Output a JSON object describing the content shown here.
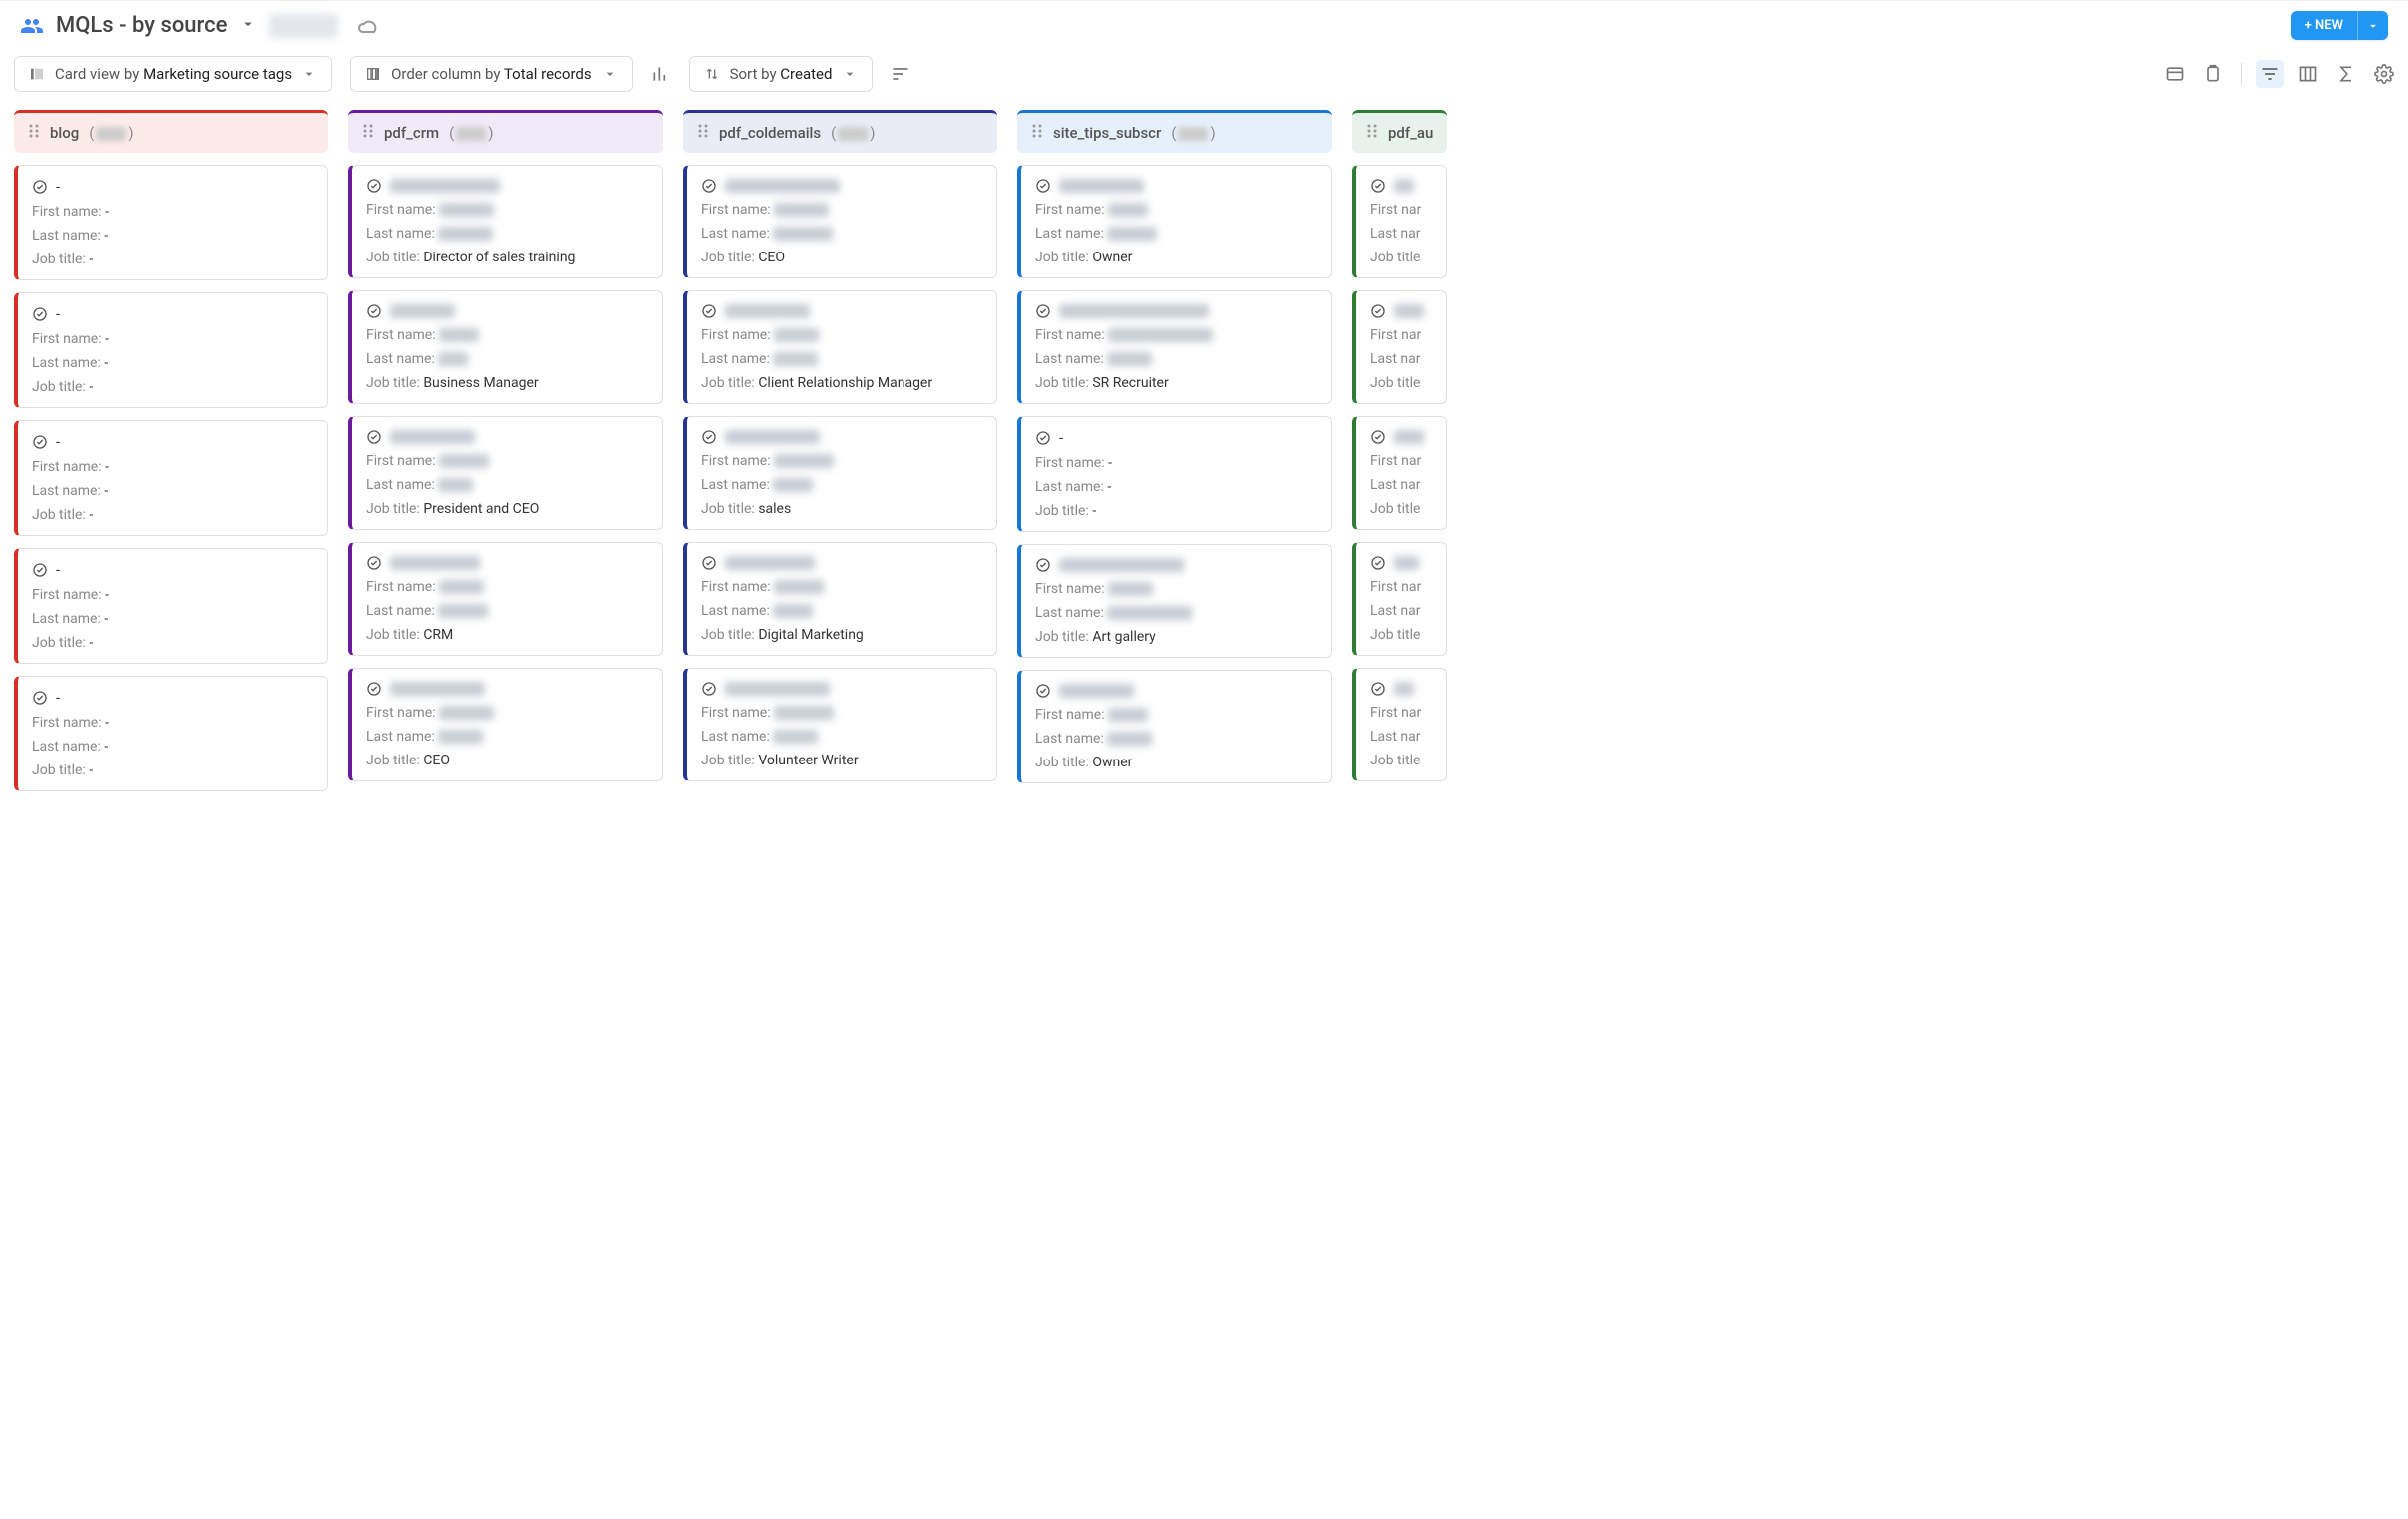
{
  "header": {
    "title": "MQLs - by source",
    "new_button": "+ NEW"
  },
  "toolbar": {
    "card_view_prefix": "Card view by ",
    "card_view_value": "Marketing source tags",
    "order_prefix": "Order column by ",
    "order_value": "Total records",
    "sort_prefix": "Sort by ",
    "sort_value": "Created"
  },
  "fields": {
    "first_name": "First name: ",
    "last_name": "Last name: ",
    "job_title": "Job title: "
  },
  "columns": [
    {
      "id": "blog",
      "name": "blog",
      "color": "red",
      "cards": [
        {
          "title": "-",
          "title_blur": 0,
          "first": "-",
          "first_blur": 0,
          "last": "-",
          "last_blur": 0,
          "job": "-",
          "job_blur": 0
        },
        {
          "title": "-",
          "title_blur": 0,
          "first": "-",
          "first_blur": 0,
          "last": "-",
          "last_blur": 0,
          "job": "-",
          "job_blur": 0
        },
        {
          "title": "-",
          "title_blur": 0,
          "first": "-",
          "first_blur": 0,
          "last": "-",
          "last_blur": 0,
          "job": "-",
          "job_blur": 0
        },
        {
          "title": "-",
          "title_blur": 0,
          "first": "-",
          "first_blur": 0,
          "last": "-",
          "last_blur": 0,
          "job": "-",
          "job_blur": 0
        },
        {
          "title": "-",
          "title_blur": 0,
          "first": "-",
          "first_blur": 0,
          "last": "-",
          "last_blur": 0,
          "job": "-",
          "job_blur": 0
        }
      ]
    },
    {
      "id": "pdf_crm",
      "name": "pdf_crm",
      "color": "purple",
      "cards": [
        {
          "title": "",
          "title_blur": 110,
          "first": "",
          "first_blur": 55,
          "last": "",
          "last_blur": 55,
          "job": "Director of sales training",
          "job_blur": 0
        },
        {
          "title": "",
          "title_blur": 65,
          "first": "",
          "first_blur": 40,
          "last": "",
          "last_blur": 30,
          "job": "Business Manager",
          "job_blur": 0
        },
        {
          "title": "",
          "title_blur": 85,
          "first": "",
          "first_blur": 50,
          "last": "",
          "last_blur": 35,
          "job": "President and CEO",
          "job_blur": 0
        },
        {
          "title": "",
          "title_blur": 90,
          "first": "",
          "first_blur": 45,
          "last": "",
          "last_blur": 50,
          "job": "CRM",
          "job_blur": 0
        },
        {
          "title": "",
          "title_blur": 95,
          "first": "",
          "first_blur": 55,
          "last": "",
          "last_blur": 45,
          "job": "CEO",
          "job_blur": 0
        }
      ]
    },
    {
      "id": "pdf_coldemails",
      "name": "pdf_coldemails",
      "color": "navy",
      "cards": [
        {
          "title": "",
          "title_blur": 115,
          "first": "",
          "first_blur": 55,
          "last": "",
          "last_blur": 60,
          "job": "CEO",
          "job_blur": 0
        },
        {
          "title": "",
          "title_blur": 85,
          "first": "",
          "first_blur": 45,
          "last": "",
          "last_blur": 45,
          "job": "Client Relationship Manager",
          "job_blur": 0
        },
        {
          "title": "",
          "title_blur": 95,
          "first": "",
          "first_blur": 60,
          "last": "",
          "last_blur": 40,
          "job": "sales",
          "job_blur": 0
        },
        {
          "title": "",
          "title_blur": 90,
          "first": "",
          "first_blur": 50,
          "last": "",
          "last_blur": 40,
          "job": "Digital Marketing",
          "job_blur": 0
        },
        {
          "title": "",
          "title_blur": 105,
          "first": "",
          "first_blur": 60,
          "last": "",
          "last_blur": 45,
          "job": "Volunteer Writer",
          "job_blur": 0
        }
      ]
    },
    {
      "id": "site_tips_subscr",
      "name": "site_tips_subscr",
      "color": "blue",
      "cards": [
        {
          "title": "",
          "title_blur": 85,
          "first": "",
          "first_blur": 40,
          "last": "",
          "last_blur": 50,
          "job": "Owner",
          "job_blur": 0
        },
        {
          "title": "",
          "title_blur": 150,
          "first": "",
          "first_blur": 105,
          "last": "",
          "last_blur": 45,
          "job": "SR Recruiter",
          "job_blur": 0
        },
        {
          "title": "-",
          "title_blur": 0,
          "first": "-",
          "first_blur": 0,
          "last": "-",
          "last_blur": 0,
          "job": "-",
          "job_blur": 0
        },
        {
          "title": "",
          "title_blur": 125,
          "first": "",
          "first_blur": 45,
          "last": "",
          "last_blur": 85,
          "job": "Art gallery",
          "job_blur": 0
        },
        {
          "title": "",
          "title_blur": 75,
          "first": "",
          "first_blur": 40,
          "last": "",
          "last_blur": 45,
          "job": "Owner",
          "job_blur": 0
        }
      ]
    },
    {
      "id": "pdf_au",
      "name": "pdf_au",
      "color": "green",
      "partial": true,
      "cards": [
        {
          "title": "",
          "title_blur": 20,
          "first": "",
          "first_blur": 0,
          "last": "",
          "last_blur": 0,
          "job": "",
          "job_blur": 0,
          "truncated": true
        },
        {
          "title": "",
          "title_blur": 30,
          "first": "",
          "first_blur": 0,
          "last": "",
          "last_blur": 0,
          "job": "",
          "job_blur": 0,
          "truncated": true
        },
        {
          "title": "",
          "title_blur": 30,
          "first": "",
          "first_blur": 0,
          "last": "",
          "last_blur": 0,
          "job": "",
          "job_blur": 0,
          "truncated": true
        },
        {
          "title": "",
          "title_blur": 25,
          "first": "",
          "first_blur": 0,
          "last": "",
          "last_blur": 0,
          "job": "",
          "job_blur": 0,
          "truncated": true
        },
        {
          "title": "",
          "title_blur": 20,
          "first": "",
          "first_blur": 0,
          "last": "",
          "last_blur": 0,
          "job": "",
          "job_blur": 0,
          "truncated": true
        }
      ]
    }
  ]
}
